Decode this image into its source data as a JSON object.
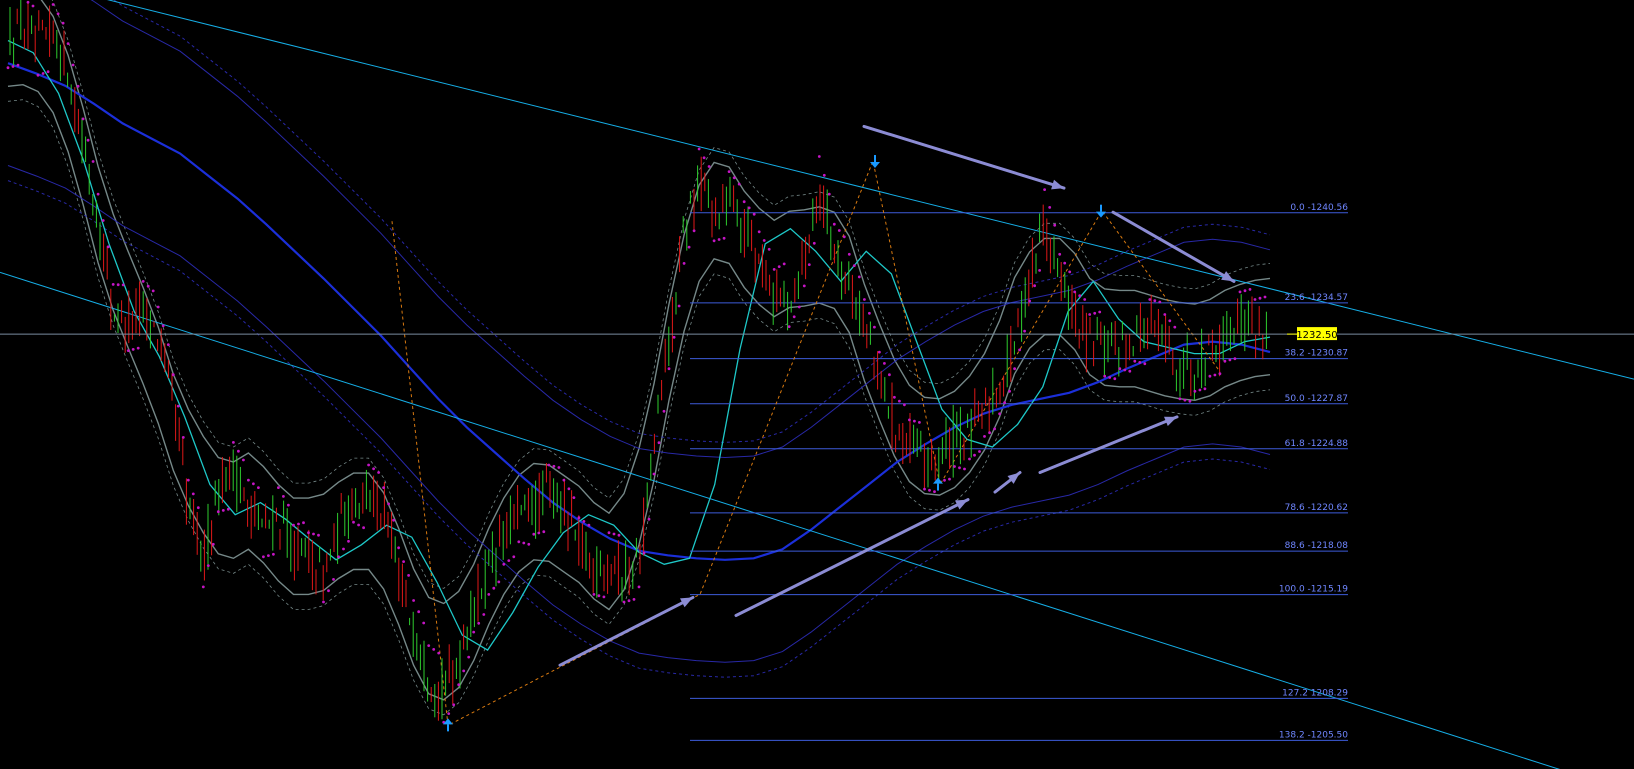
{
  "chart_data": {
    "type": "line",
    "title": "",
    "xlabel": "",
    "ylabel": "",
    "ylim": [
      1203.6,
      1254.7
    ],
    "grid": false,
    "colors": {
      "background": "#000000",
      "bull_candle": "#2ecc2e",
      "bear_candle": "#e01818",
      "fib_line": "#3d5bd9",
      "fib_label": "#6f86ff",
      "trendline": "#16aee6",
      "moving_average_slow": "#1b2fd9",
      "moving_average_fast": "#1ec8c8",
      "envelope": "#8aa0a0",
      "envelope_outer": "#2c2cb8",
      "parabolic_sar": "#c515c5",
      "zigzag": "#d97a10",
      "arrow": "#8c8cd4",
      "fractal": "#1a9aff",
      "price_badge": "#ffff00"
    },
    "current_price": {
      "value": "1232.50",
      "price": 1232.5
    },
    "fibonacci": {
      "high": 1240.56,
      "low": 1215.19,
      "levels": [
        {
          "label": "0.0 -1240.56",
          "price": 1240.56
        },
        {
          "label": "23.6 -1234.57",
          "price": 1234.57
        },
        {
          "label": "38.2 -1230.87",
          "price": 1230.87
        },
        {
          "label": "50.0 -1227.87",
          "price": 1227.87
        },
        {
          "label": "61.8 -1224.88",
          "price": 1224.88
        },
        {
          "label": "78.6 -1220.62",
          "price": 1220.62
        },
        {
          "label": "88.6 -1218.08",
          "price": 1218.08
        },
        {
          "label": "100.0 -1215.19",
          "price": 1215.19
        },
        {
          "label": "127.2 1208.29",
          "price": 1208.29
        },
        {
          "label": "138.2 -1205.50",
          "price": 1205.5
        }
      ]
    },
    "price_path": [
      1252.0,
      1253.0,
      1251.5,
      1252.6,
      1250.0,
      1245.0,
      1240.0,
      1234.0,
      1233.2,
      1234.2,
      1232.5,
      1228.0,
      1221.0,
      1217.5,
      1222.5,
      1223.5,
      1221.0,
      1219.5,
      1220.5,
      1218.0,
      1217.5,
      1216.5,
      1219.5,
      1221.8,
      1222.0,
      1220.5,
      1216.5,
      1213.0,
      1210.0,
      1208.5,
      1211.0,
      1214.5,
      1217.0,
      1219.0,
      1220.5,
      1221.0,
      1222.0,
      1221.0,
      1218.5,
      1217.0,
      1217.5,
      1216.5,
      1217.5,
      1225.0,
      1232.0,
      1239.0,
      1243.0,
      1240.5,
      1241.5,
      1239.5,
      1237.5,
      1235.0,
      1234.8,
      1237.5,
      1242.5,
      1238.0,
      1236.0,
      1233.0,
      1229.5,
      1226.5,
      1225.0,
      1224.0,
      1224.5,
      1225.5,
      1226.0,
      1227.5,
      1229.0,
      1232.0,
      1236.5,
      1240.3,
      1236.0,
      1233.5,
      1232.0,
      1231.5,
      1232.0,
      1232.5,
      1233.0,
      1232.0,
      1230.0,
      1230.5,
      1231.5,
      1232.5,
      1233.5,
      1233.0,
      1232.5
    ],
    "moving_average_slow": [
      1250.5,
      1249.8,
      1249.0,
      1247.8,
      1246.5,
      1245.5,
      1244.5,
      1243.0,
      1241.5,
      1239.8,
      1238.0,
      1236.2,
      1234.3,
      1232.4,
      1230.3,
      1228.2,
      1226.3,
      1224.6,
      1222.9,
      1221.3,
      1220.0,
      1218.9,
      1218.1,
      1217.8,
      1217.6,
      1217.5,
      1217.6,
      1218.2,
      1219.5,
      1221.0,
      1222.5,
      1224.0,
      1225.2,
      1226.3,
      1227.2,
      1227.8,
      1228.2,
      1228.6,
      1229.3,
      1230.2,
      1231.0,
      1231.8,
      1232.0,
      1231.8,
      1231.3
    ],
    "moving_average_fast": [
      1252.0,
      1251.2,
      1248.5,
      1244.0,
      1238.5,
      1234.0,
      1231.0,
      1227.0,
      1222.5,
      1220.5,
      1221.3,
      1220.2,
      1218.8,
      1217.5,
      1218.5,
      1219.8,
      1219.0,
      1216.0,
      1212.5,
      1211.5,
      1214.0,
      1217.0,
      1219.3,
      1220.5,
      1219.8,
      1218.0,
      1217.2,
      1217.6,
      1222.5,
      1231.5,
      1238.5,
      1239.5,
      1238.0,
      1236.0,
      1238.0,
      1236.5,
      1232.0,
      1227.5,
      1225.5,
      1225.0,
      1226.5,
      1229.0,
      1234.0,
      1236.0,
      1233.5,
      1232.0,
      1231.6,
      1231.2,
      1231.2,
      1232.0,
      1232.3
    ],
    "trendlines": [
      {
        "from": 1256.5,
        "to": 1229.5
      },
      {
        "from": 1236.6,
        "to": 1202.0
      }
    ],
    "arrows": [
      {
        "direction": "down",
        "from": 1246.3,
        "to": 1242.2
      },
      {
        "direction": "down",
        "from": 1240.6,
        "to": 1236.0
      },
      {
        "direction": "up",
        "from": 1210.5,
        "to": 1215.0
      },
      {
        "direction": "up",
        "from": 1213.8,
        "to": 1221.5
      },
      {
        "direction": "up",
        "from": 1222.0,
        "to": 1223.3
      },
      {
        "direction": "up",
        "from": 1223.3,
        "to": 1227.0
      }
    ],
    "fractals": [
      {
        "direction": "up",
        "price": 1206.5
      },
      {
        "direction": "down",
        "price": 1244.0
      },
      {
        "direction": "up",
        "price": 1222.5
      },
      {
        "direction": "down",
        "price": 1240.7
      }
    ]
  }
}
